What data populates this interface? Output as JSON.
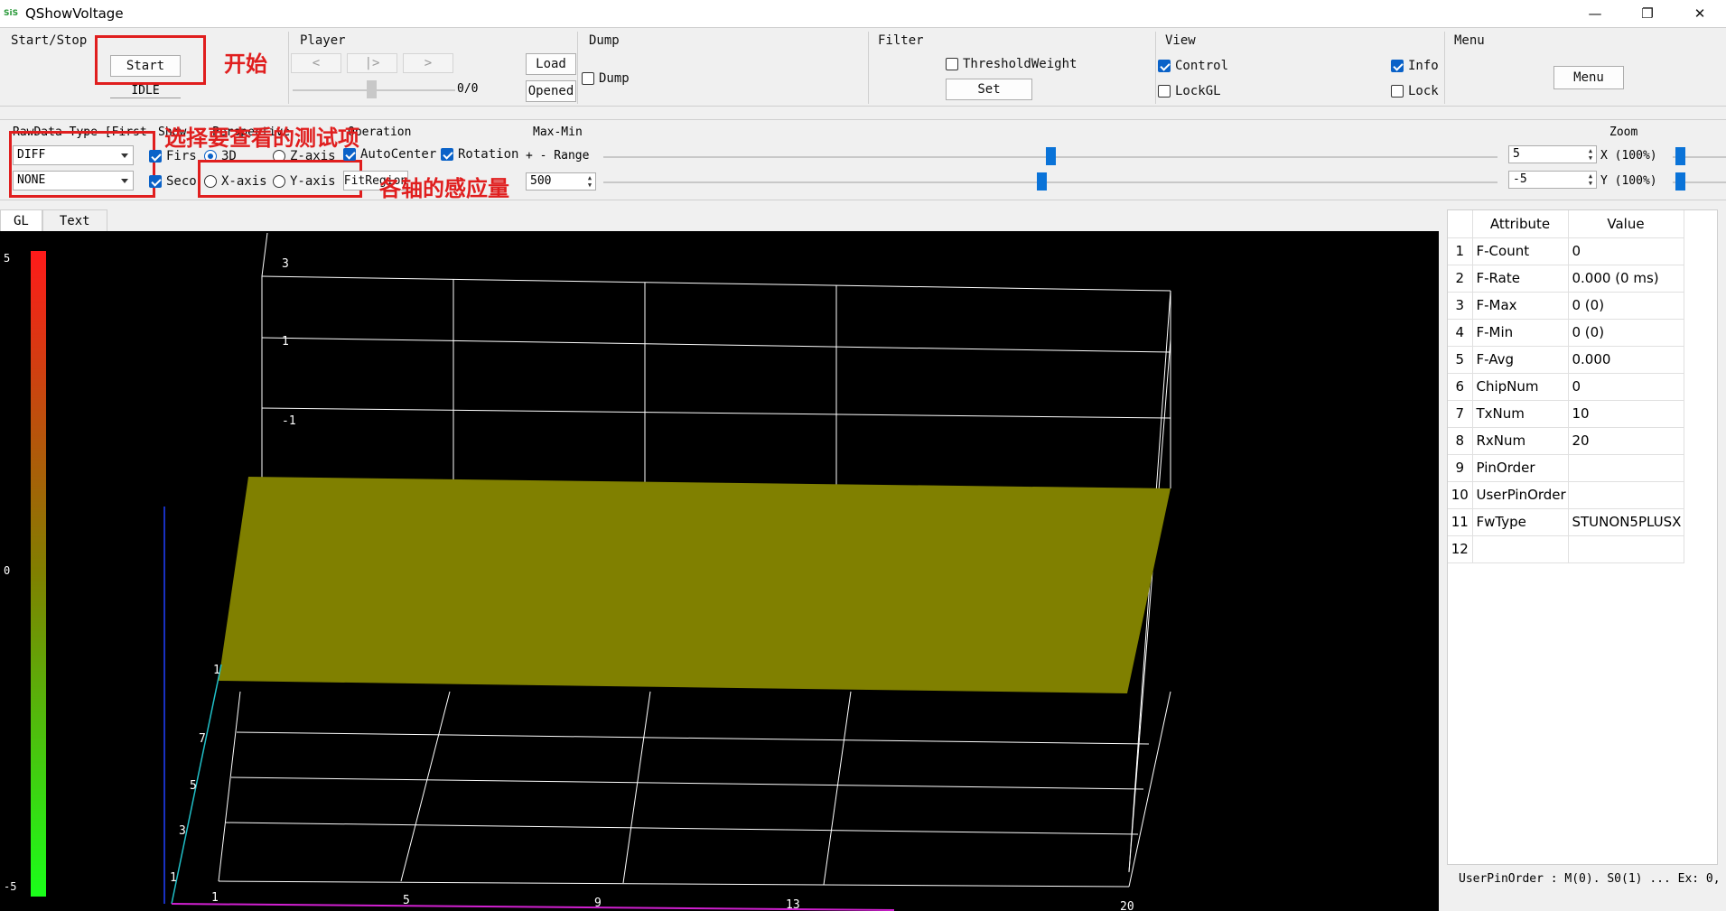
{
  "window": {
    "title": "QShowVoltage",
    "icon_text": "SiS",
    "controls": [
      "—",
      "❐",
      "✕"
    ]
  },
  "startstop": {
    "title": "Start/Stop",
    "start_label": "Start",
    "state_label": "IDLE"
  },
  "player": {
    "title": "Player",
    "prev_label": "<",
    "play_label": "|>",
    "next_label": ">",
    "counter": "0/0",
    "load_label": "Load",
    "opened_label": "Opened"
  },
  "dump": {
    "title": "Dump",
    "dump_label": "Dump"
  },
  "filter": {
    "title": "Filter",
    "threshold_label": "ThresholdWeight",
    "set_label": "Set"
  },
  "view": {
    "title": "View",
    "control_label": "Control",
    "info_label": "Info",
    "lockgl_label": "LockGL",
    "lock_label": "Lock"
  },
  "menu": {
    "title": "Menu",
    "menu_label": "Menu"
  },
  "annotations": {
    "start": "开始",
    "select_item": "选择要查看的测试项",
    "axis_sense": "各轴的感应量"
  },
  "rawdata": {
    "title": "RawData Type [First",
    "combo1": "DIFF",
    "combo2": "NONE"
  },
  "show": {
    "title": "Show",
    "first_label": "Firs",
    "second_label": "Seco"
  },
  "perspective": {
    "title": "Perspective",
    "d3_label": "3D",
    "z_label": "Z-axis",
    "x_label": "X-axis",
    "y_label": "Y-axis"
  },
  "operation": {
    "title": "Operation",
    "autocenter_label": "AutoCenter",
    "rotation_label": "Rotation",
    "fitregion_label": "FitRegion"
  },
  "maxmin": {
    "title": "Max-Min",
    "range_label": "+ - Range",
    "range_value": "500",
    "max_value": "5",
    "min_value": "-5",
    "max_slider": 0.5,
    "min_slider": 0.5
  },
  "zoom": {
    "title": "Zoom",
    "x_label": "X (100%)",
    "y_label": "Y (100%)"
  },
  "tabs": [
    "GL",
    "Text"
  ],
  "gl": {
    "colorbar_labels": [
      "5",
      "0",
      "-5"
    ],
    "colorbar_top": "#ff1a1a",
    "colorbar_mid": "#808000",
    "colorbar_bottom": "#1aff1a",
    "surface_color": "#808000",
    "z_ticks": [
      "3",
      "1",
      "-1"
    ],
    "y_ticks": [
      "1",
      "7",
      "5",
      "3",
      "1"
    ],
    "x_ticks": [
      "1",
      "5",
      "9",
      "13",
      "20"
    ]
  },
  "attributes": {
    "headers": [
      "Attribute",
      "Value"
    ],
    "rows": [
      {
        "idx": "1",
        "attr": "F-Count",
        "value": "0"
      },
      {
        "idx": "2",
        "attr": "F-Rate",
        "value": "0.000 (0 ms)"
      },
      {
        "idx": "3",
        "attr": "F-Max",
        "value": "0 (0)"
      },
      {
        "idx": "4",
        "attr": "F-Min",
        "value": "0 (0)"
      },
      {
        "idx": "5",
        "attr": "F-Avg",
        "value": "0.000"
      },
      {
        "idx": "6",
        "attr": "ChipNum",
        "value": "0"
      },
      {
        "idx": "7",
        "attr": "TxNum",
        "value": "10"
      },
      {
        "idx": "8",
        "attr": "RxNum",
        "value": "20"
      },
      {
        "idx": "9",
        "attr": "PinOrder",
        "value": ""
      },
      {
        "idx": "10",
        "attr": "UserPinOrder",
        "value": ""
      },
      {
        "idx": "11",
        "attr": "FwType",
        "value": "STUNON5PLUSX"
      },
      {
        "idx": "12",
        "attr": "",
        "value": ""
      }
    ]
  },
  "status": {
    "text": "UserPinOrder : M(0). S0(1) ... Ex: 0,"
  }
}
